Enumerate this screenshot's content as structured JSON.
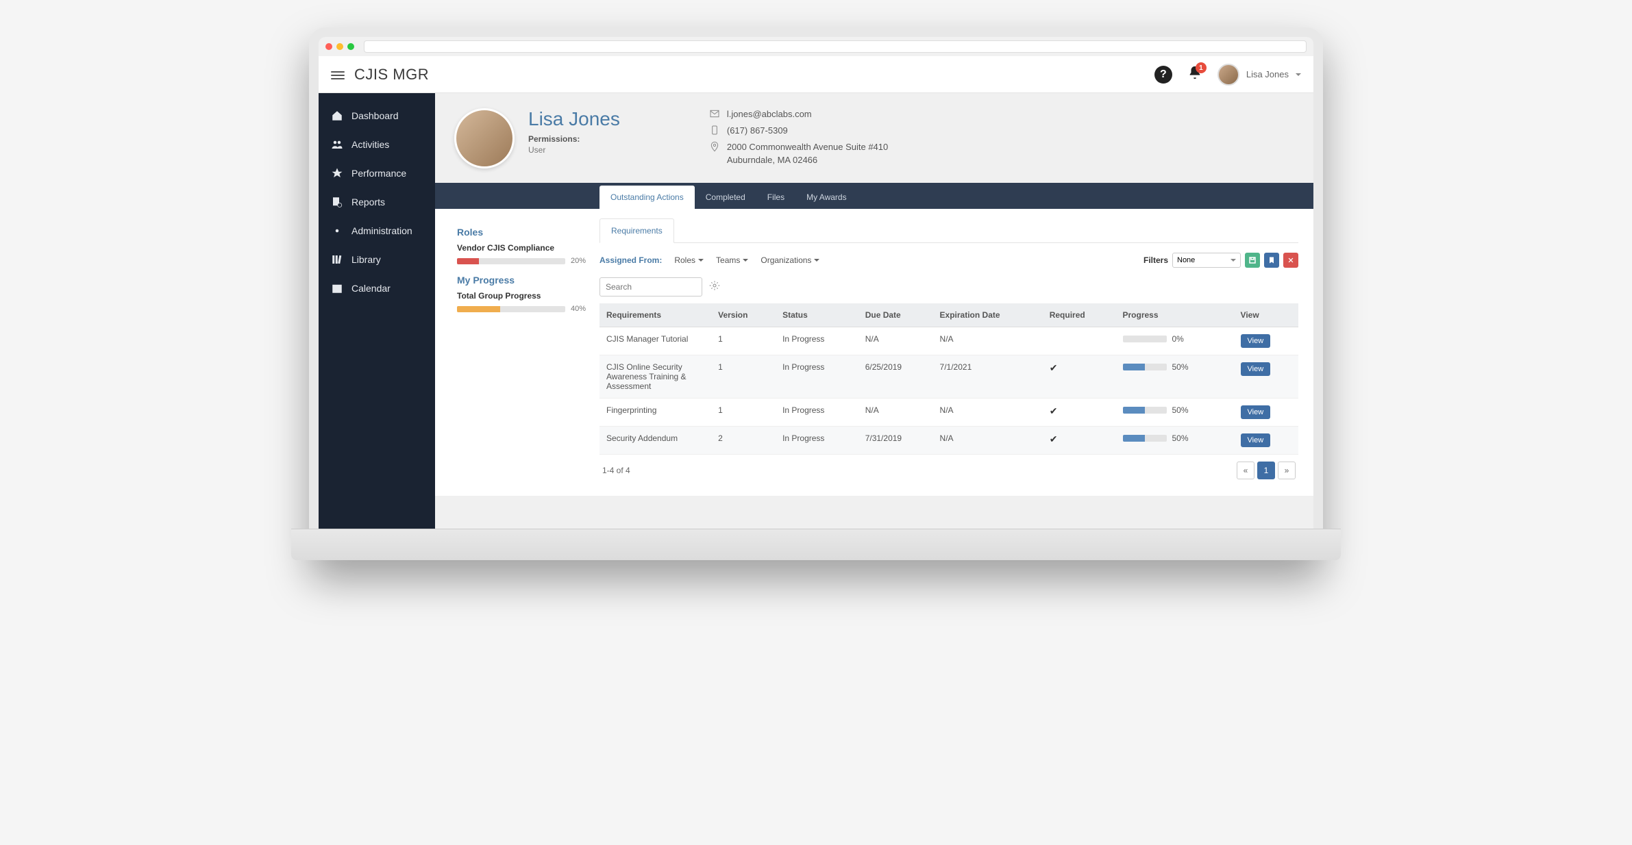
{
  "app_title": "CJIS MGR",
  "notifications": {
    "count": "1"
  },
  "current_user": {
    "name": "Lisa Jones"
  },
  "sidebar": {
    "items": [
      {
        "label": "Dashboard"
      },
      {
        "label": "Activities"
      },
      {
        "label": "Performance"
      },
      {
        "label": "Reports"
      },
      {
        "label": "Administration"
      },
      {
        "label": "Library"
      },
      {
        "label": "Calendar"
      }
    ]
  },
  "profile": {
    "name": "Lisa Jones",
    "permissions_label": "Permissions:",
    "permissions_value": "User",
    "email": "l.jones@abclabs.com",
    "phone": "(617) 867-5309",
    "address_line1": "2000 Commonwealth Avenue Suite #410",
    "address_line2": "Auburndale, MA 02466"
  },
  "tabs": {
    "items": [
      {
        "label": "Outstanding Actions",
        "active": true
      },
      {
        "label": "Completed"
      },
      {
        "label": "Files"
      },
      {
        "label": "My Awards"
      }
    ]
  },
  "left_panel": {
    "roles_heading": "Roles",
    "role_name": "Vendor CJIS Compliance",
    "role_pct": "20%",
    "role_pct_num": 20,
    "progress_heading": "My Progress",
    "group_label": "Total Group Progress",
    "group_pct": "40%",
    "group_pct_num": 40
  },
  "subtab": {
    "label": "Requirements"
  },
  "assigned": {
    "label": "Assigned From:",
    "dropdowns": [
      "Roles",
      "Teams",
      "Organizations"
    ]
  },
  "filters": {
    "label": "Filters",
    "selected": "None"
  },
  "search": {
    "placeholder": "Search"
  },
  "table": {
    "headers": [
      "Requirements",
      "Version",
      "Status",
      "Due Date",
      "Expiration Date",
      "Required",
      "Progress",
      "View"
    ],
    "rows": [
      {
        "name": "CJIS Manager Tutorial",
        "version": "1",
        "status": "In Progress",
        "due": "N/A",
        "exp": "N/A",
        "required": false,
        "progress": 0,
        "progress_label": "0%",
        "view": "View"
      },
      {
        "name": "CJIS Online Security Awareness Training & Assessment",
        "version": "1",
        "status": "In Progress",
        "due": "6/25/2019",
        "exp": "7/1/2021",
        "required": true,
        "progress": 50,
        "progress_label": "50%",
        "view": "View"
      },
      {
        "name": "Fingerprinting",
        "version": "1",
        "status": "In Progress",
        "due": "N/A",
        "exp": "N/A",
        "required": true,
        "progress": 50,
        "progress_label": "50%",
        "view": "View"
      },
      {
        "name": "Security Addendum",
        "version": "2",
        "status": "In Progress",
        "due": "7/31/2019",
        "exp": "N/A",
        "required": true,
        "progress": 50,
        "progress_label": "50%",
        "view": "View"
      }
    ],
    "footer_count": "1-4 of 4",
    "pager": {
      "prev": "«",
      "page": "1",
      "next": "»"
    }
  }
}
